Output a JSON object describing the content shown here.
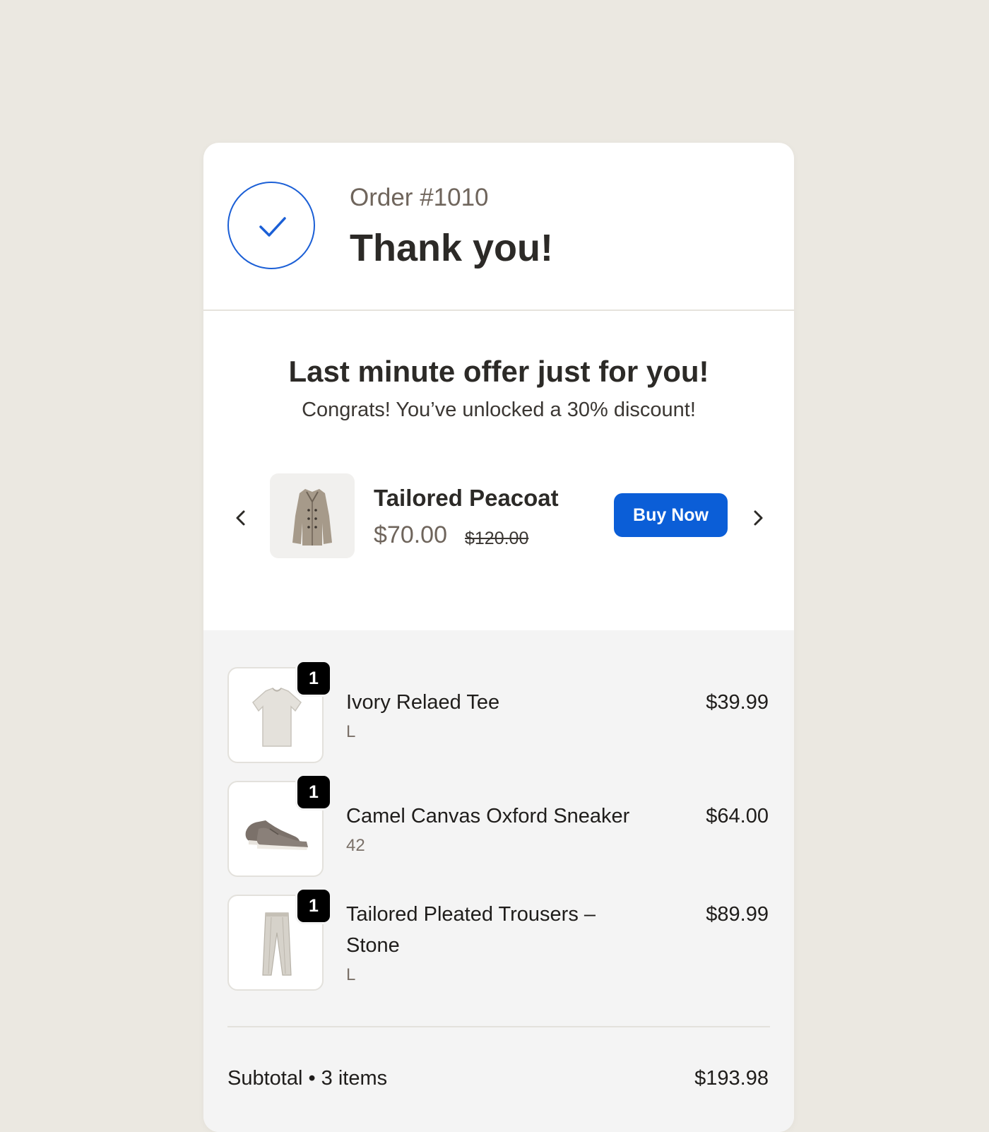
{
  "header": {
    "order_number": "Order #1010",
    "title": "Thank you!"
  },
  "offer": {
    "title": "Last minute offer just for you!",
    "subtitle": "Congrats! You’ve unlocked a 30% discount!",
    "product_name": "Tailored Peacoat",
    "price": "$70.00",
    "original_price": "$120.00",
    "buy_label": "Buy Now"
  },
  "items": [
    {
      "name": "Ivory Relaed Tee",
      "variant": "L",
      "price": "$39.99",
      "quantity": "1"
    },
    {
      "name": "Camel Canvas Oxford Sneaker",
      "variant": "42",
      "price": "$64.00",
      "quantity": "1"
    },
    {
      "name": "Tailored Pleated Trousers – Stone",
      "variant": "L",
      "price": "$89.99",
      "quantity": "1"
    }
  ],
  "summary": {
    "subtotal_label": "Subtotal • 3 items",
    "subtotal_value": "$193.98"
  },
  "colors": {
    "accent": "#0b5ed7",
    "background": "#ebe8e1",
    "summary_background": "#f4f4f4"
  },
  "icons": [
    "check-icon",
    "chevron-left-icon",
    "chevron-right-icon",
    "peacoat-image",
    "tee-image",
    "sneaker-image",
    "trousers-image"
  ]
}
